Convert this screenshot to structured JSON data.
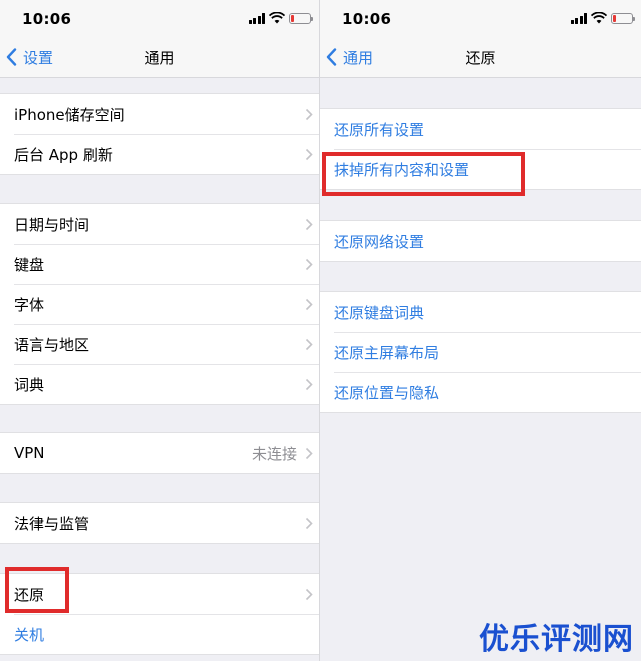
{
  "left": {
    "status": {
      "time": "10:06"
    },
    "nav": {
      "back_label": "设置",
      "title": "通用"
    },
    "groups": {
      "g1": [
        "iPhone储存空间",
        "后台 App 刷新"
      ],
      "g2": [
        "日期与时间",
        "键盘",
        "字体",
        "语言与地区",
        "词典"
      ],
      "vpn": {
        "label": "VPN",
        "value": "未连接"
      },
      "legal": "法律与监管",
      "reset": "还原",
      "shutdown": "关机"
    }
  },
  "right": {
    "status": {
      "time": "10:06"
    },
    "nav": {
      "back_label": "通用",
      "title": "还原"
    },
    "groups": {
      "g1": [
        "还原所有设置",
        "抹掉所有内容和设置"
      ],
      "g2": [
        "还原网络设置"
      ],
      "g3": [
        "还原键盘词典",
        "还原主屏幕布局",
        "还原位置与隐私"
      ]
    }
  },
  "watermark": "优乐评测网",
  "colors": {
    "accent": "#2f7de1",
    "highlight": "#e02b2b",
    "background": "#efeff4",
    "watermark": "#1a50d0"
  },
  "icons": [
    "chevron-left-icon",
    "chevron-right-icon",
    "cellular-signal-icon",
    "wifi-icon",
    "battery-icon"
  ]
}
